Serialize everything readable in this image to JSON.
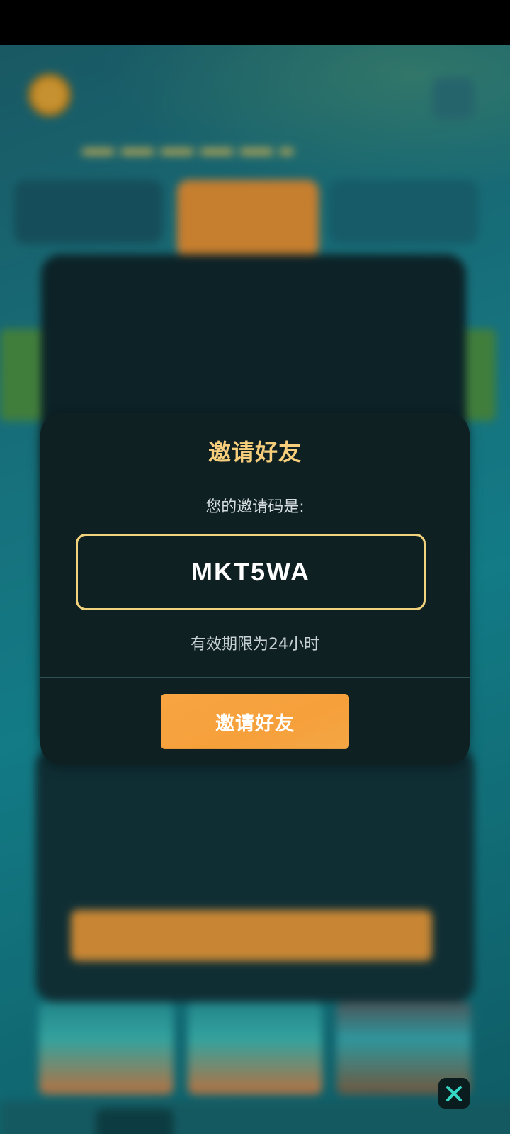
{
  "dialog": {
    "title": "邀请好友",
    "subtitle": "您的邀请码是:",
    "invite_code": "MKT5WA",
    "validity_note": "有效期限为24小时",
    "invite_button_label": "邀请好友"
  },
  "overlay": {
    "close_icon": "close-icon"
  },
  "colors": {
    "dialog_bg": "#0f2022",
    "title": "#f7cf7c",
    "code_border": "#f3d27d",
    "button": "#f6a03b",
    "close_icon": "#36d6c4"
  }
}
